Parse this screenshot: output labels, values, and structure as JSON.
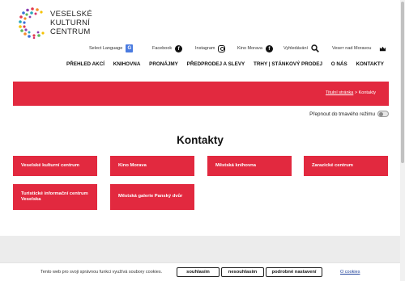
{
  "logo": {
    "line1": "VESELSKÉ",
    "line2": "KULTURNÍ",
    "line3": "CENTRUM"
  },
  "topbar": {
    "language": "Select Language",
    "facebook": "Facebook",
    "instagram": "Instagram",
    "kino": "Kino Morava",
    "search": "Vyhledávání",
    "veset": "Veseт nad Moravou"
  },
  "nav": [
    "PŘEHLED AKCÍ",
    "KNIHOVNA",
    "PRONÁJMY",
    "PŘEDPRODEJ A SLEVY",
    "TRHY | STÁNKOVÝ PRODEJ",
    "O NÁS",
    "KONTAKTY"
  ],
  "breadcrumb": {
    "home": "Titulní stránka",
    "sep": " > ",
    "current": "Kontakty"
  },
  "darkmode_label": "Přepnout do tmavého režimu",
  "page_title": "Kontakty",
  "cards": [
    "Veselské kulturní centrum",
    "Kino Morava",
    "Městská knihovna",
    "Zarazické centrum",
    "Turistické informační centrum Veselska",
    "Městská galerie Panský dvůr"
  ],
  "cookie": {
    "message": "Tento web pro svoji správnou funkci využívá soubory cookies.",
    "accept": "souhlasím",
    "reject": "nesouhlasím",
    "settings": "podrobné nastavení",
    "link": "O cookies"
  },
  "colors": {
    "accent": "#e2293f",
    "footer": "#ececec"
  }
}
